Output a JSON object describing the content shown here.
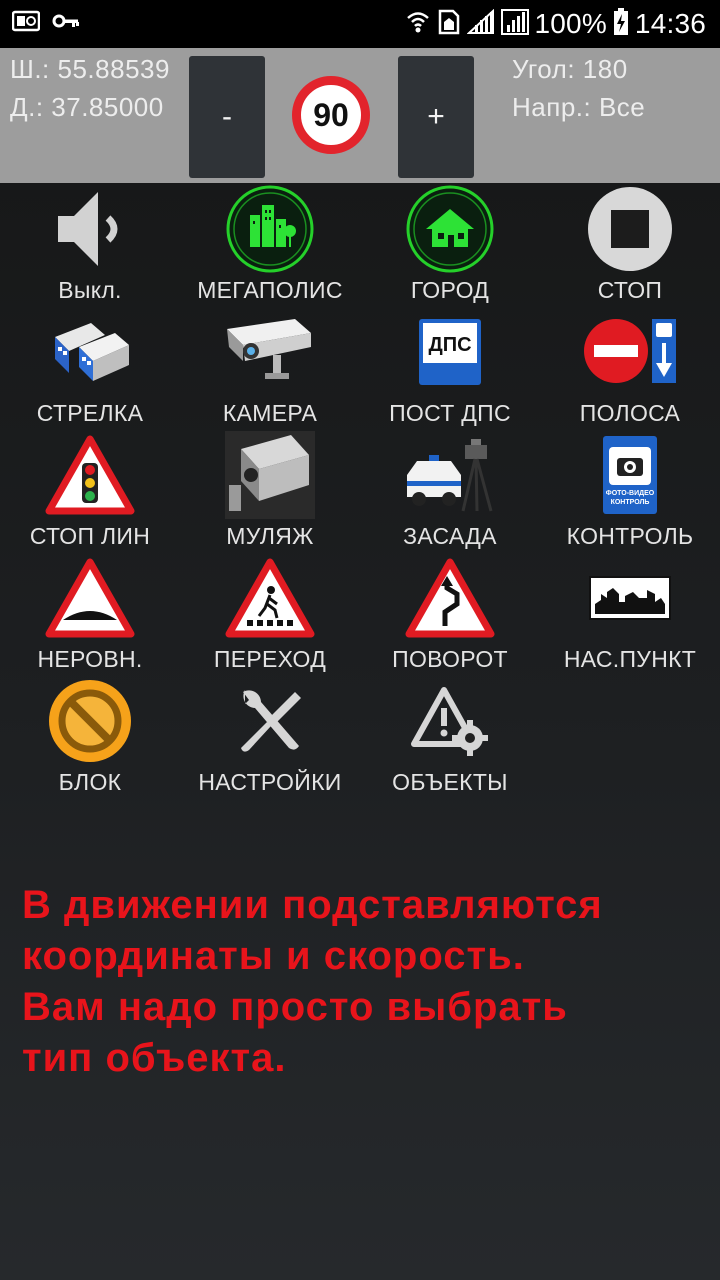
{
  "status_bar": {
    "battery_percent": "100%",
    "time": "14:36",
    "icons": [
      "screenshot-icon",
      "key-icon",
      "wifi-icon",
      "sim-icon",
      "signal-icon",
      "signal-icon",
      "battery-charging-icon"
    ]
  },
  "panel": {
    "lat": "Ш.: 55.88539",
    "lon": "Д.: 37.85000",
    "minus_label": "-",
    "speed_value": "90",
    "plus_label": "+",
    "angle": "Угол: 180",
    "direction": "Напр.: Все"
  },
  "grid": {
    "items": [
      {
        "label": "Выкл."
      },
      {
        "label": "МЕГАПОЛИС"
      },
      {
        "label": "ГОРОД"
      },
      {
        "label": "СТОП"
      },
      {
        "label": "СТРЕЛКА"
      },
      {
        "label": "КАМЕРА"
      },
      {
        "label": "ПОСТ ДПС",
        "sign_text": "ДПС"
      },
      {
        "label": "ПОЛОСА"
      },
      {
        "label": "СТОП ЛИН"
      },
      {
        "label": "МУЛЯЖ"
      },
      {
        "label": "ЗАСАДА"
      },
      {
        "label": "КОНТРОЛЬ",
        "sign_text_1": "ФОТО-ВИДЕО",
        "sign_text_2": "КОНТРОЛЬ"
      },
      {
        "label": "НЕРОВН."
      },
      {
        "label": "ПЕРЕХОД"
      },
      {
        "label": "ПОВОРОТ"
      },
      {
        "label": "НАС.ПУНКТ"
      },
      {
        "label": "БЛОК"
      },
      {
        "label": "НАСТРОЙКИ"
      },
      {
        "label": "ОБЪЕКТЫ"
      }
    ]
  },
  "message": {
    "lines": [
      "В движении подставляются",
      "координаты и скорость.",
      "Вам надо просто выбрать",
      "тип объекта."
    ]
  }
}
